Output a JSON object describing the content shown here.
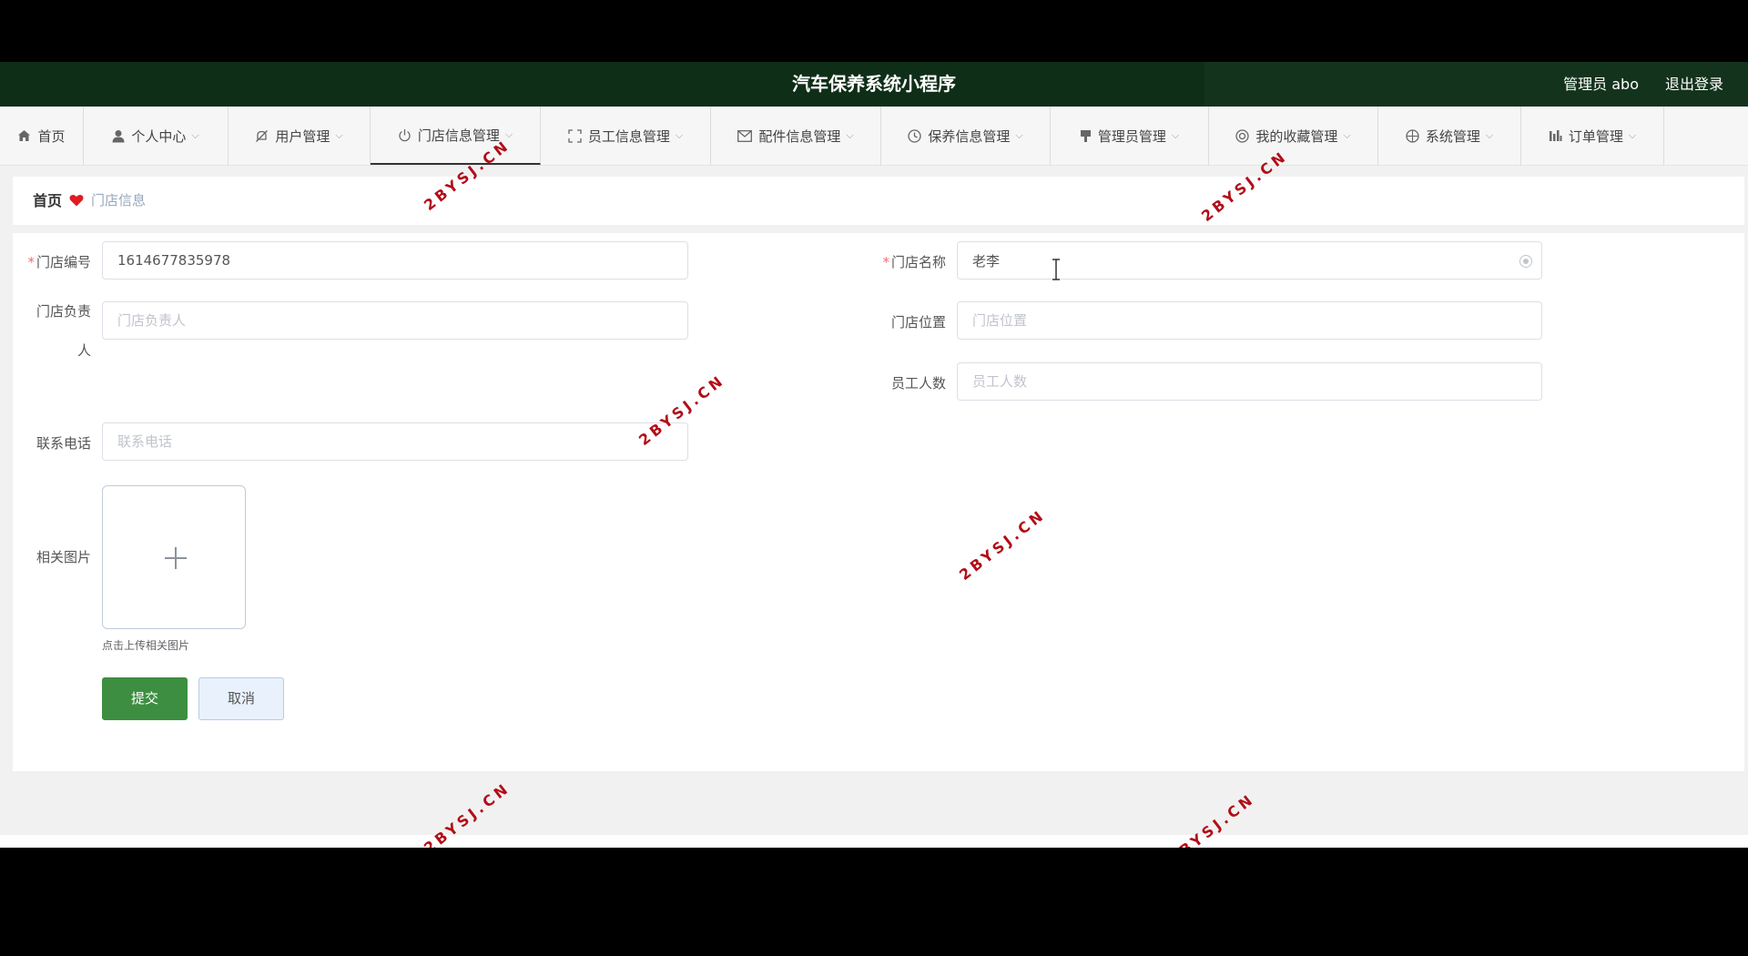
{
  "header": {
    "app_title": "汽车保养系统小程序",
    "user_label": "管理员 abo",
    "logout_label": "退出登录"
  },
  "menu": [
    {
      "label": "首页",
      "icon": "home-icon",
      "has_dropdown": false
    },
    {
      "label": "个人中心",
      "icon": "user-icon",
      "has_dropdown": true
    },
    {
      "label": "用户管理",
      "icon": "bell-off-icon",
      "has_dropdown": true
    },
    {
      "label": "门店信息管理",
      "icon": "power-icon",
      "has_dropdown": true,
      "active": true
    },
    {
      "label": "员工信息管理",
      "icon": "fullscreen-icon",
      "has_dropdown": true
    },
    {
      "label": "配件信息管理",
      "icon": "mail-icon",
      "has_dropdown": true
    },
    {
      "label": "保养信息管理",
      "icon": "clock-icon",
      "has_dropdown": true
    },
    {
      "label": "管理员管理",
      "icon": "stamp-icon",
      "has_dropdown": true
    },
    {
      "label": "我的收藏管理",
      "icon": "gear-circle-icon",
      "has_dropdown": true
    },
    {
      "label": "系统管理",
      "icon": "target-icon",
      "has_dropdown": true
    },
    {
      "label": "订单管理",
      "icon": "bars-chart-icon",
      "has_dropdown": true
    }
  ],
  "breadcrumb": {
    "home": "首页",
    "separator_icon": "heart-icon",
    "current": "门店信息"
  },
  "form": {
    "store_no": {
      "label": "门店编号",
      "required": true,
      "value": "1614677835978",
      "placeholder": ""
    },
    "store_name": {
      "label": "门店名称",
      "required": true,
      "value": "老李",
      "placeholder": ""
    },
    "manager": {
      "label_line1": "门店负责",
      "label_line2": "人",
      "value": "",
      "placeholder": "门店负责人"
    },
    "location": {
      "label": "门店位置",
      "value": "",
      "placeholder": "门店位置"
    },
    "staff_count": {
      "label": "员工人数",
      "value": "",
      "placeholder": "员工人数"
    },
    "phone": {
      "label": "联系电话",
      "value": "",
      "placeholder": "联系电话"
    },
    "image": {
      "label": "相关图片",
      "hint": "点击上传相关图片"
    },
    "submit_label": "提交",
    "cancel_label": "取消"
  },
  "watermark_text": "2BYSJ.CN",
  "colors": {
    "header_bg": "#0f2e18",
    "submit_bg": "#3d8e41",
    "required": "#f56c6c",
    "watermark": "#b20d17"
  }
}
